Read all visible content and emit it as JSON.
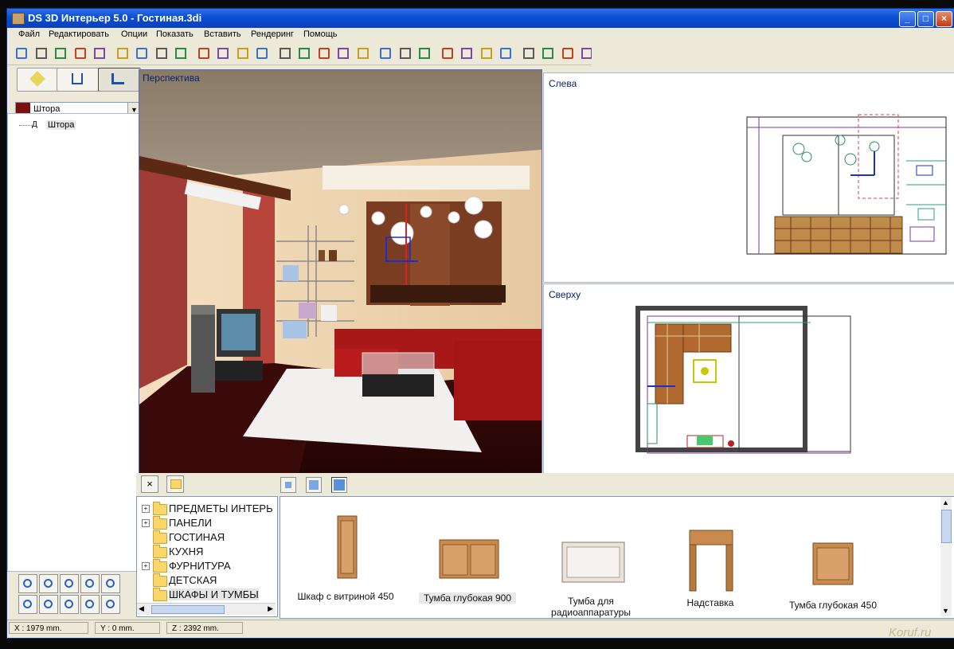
{
  "window": {
    "title": "DS 3D Интерьер 5.0 - Гостиная.3di",
    "controls": [
      "_",
      "□",
      "×"
    ]
  },
  "menu": [
    "Файл",
    "Редактировать",
    "Опции",
    "Показать",
    "Вставить",
    "Рендеринг",
    "Помощь"
  ],
  "toolbar_icons": [
    "new-icon",
    "save-icon",
    "open-icon",
    "print-preview-icon",
    "copy-view-icon",
    "cut-icon",
    "copy-icon",
    "paste-icon",
    "delete-icon",
    "print-icon",
    "screenshot-icon",
    "group-icon",
    "ungroup-icon",
    "wall-icon",
    "render-icon",
    "material-icon",
    "measure-icon",
    "angle-icon",
    "layout-icon",
    "box-icon",
    "light-icon",
    "surface-icon",
    "door-icon",
    "texture-icon",
    "camera-icon",
    "grid-icon",
    "chart-icon",
    "chart2-icon",
    "chart3-icon"
  ],
  "left_panel": {
    "tabs": [
      "brush-icon",
      "walls-icon",
      "furniture-icon"
    ],
    "object_select": {
      "value": "Штора",
      "color": "#7a1010"
    },
    "tree": [
      {
        "label": "Штора"
      }
    ],
    "nav_buttons": [
      "select-rect-icon",
      "pan-hand-icon",
      "hand-icon",
      "zoom-icon",
      "zoom-window-icon",
      "rotate-left-icon",
      "rotate-right-icon",
      "zoom-in-icon",
      "zoom-extents-icon",
      "zoom-out-icon"
    ]
  },
  "viewports": {
    "perspective": "Перспектива",
    "left": "Слева",
    "top": "Сверху"
  },
  "library": {
    "toolbar": [
      "close-icon",
      "up-folder-icon"
    ],
    "view_buttons": [
      "small-icons",
      "medium-icons",
      "large-icons"
    ],
    "categories": [
      {
        "label": "ПРЕДМЕТЫ ИНТЕРЬ",
        "expandable": true
      },
      {
        "label": "ПАНЕЛИ",
        "expandable": true
      },
      {
        "label": "ГОСТИНАЯ",
        "expandable": false
      },
      {
        "label": "КУХНЯ",
        "expandable": false
      },
      {
        "label": "ФУРНИТУРА",
        "expandable": true
      },
      {
        "label": "ДЕТСКАЯ",
        "expandable": false
      },
      {
        "label": "ШКАФЫ И ТУМБЫ",
        "expandable": false
      }
    ],
    "items": [
      {
        "label": "Шкаф с витриной 450",
        "selected": false
      },
      {
        "label": "Тумба глубокая 900",
        "selected": true
      },
      {
        "label": "Тумба для радиоаппаратуры",
        "selected": false
      },
      {
        "label": "Надставка",
        "selected": false
      },
      {
        "label": "Тумба глубокая 450",
        "selected": false
      }
    ]
  },
  "status": {
    "x": "X : 1979 mm.",
    "y": "Y : 0 mm.",
    "z": "Z : 2392 mm."
  },
  "watermark": "Koruf.ru"
}
